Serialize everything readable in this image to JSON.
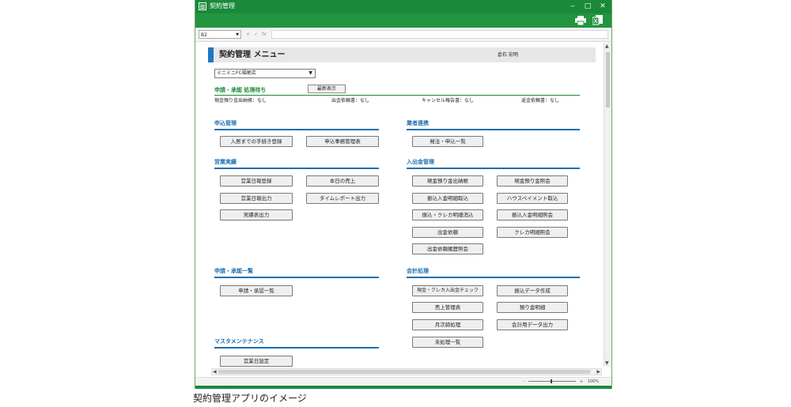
{
  "window": {
    "title": "契約管理",
    "controls": [
      "‒",
      "□",
      "✕"
    ]
  },
  "toolbar": {
    "icons": [
      "print-icon",
      "excel-export-icon"
    ]
  },
  "formula_bar": {
    "cell_ref": "B2",
    "cancel_symbol": "×",
    "enter_symbol": "✓",
    "fx_symbol": "fx",
    "formula": ""
  },
  "header": {
    "title": "契約管理 メニュー",
    "user": "倉石 宏明"
  },
  "shop_select": {
    "value": "ミニミニFC福尾店"
  },
  "pending": {
    "title": "申請・承認 処理待ち",
    "refresh_label": "最新表示",
    "items": [
      "現金預り金出納帳：なし",
      "出金依頼書：なし",
      "キャンセル報告書：なし",
      "返金依頼書：なし"
    ]
  },
  "sections": {
    "application": {
      "title": "申込管理",
      "buttons": [
        "入居までの手続き登録",
        "申込事務管理表"
      ]
    },
    "vendor": {
      "title": "業者連携",
      "buttons": [
        "発注・申込一覧"
      ]
    },
    "sales": {
      "title": "営業実績",
      "buttons": [
        "営業日報登録",
        "本日の売上",
        "営業日報出力",
        "タイムレポート出力",
        "実績表出力"
      ]
    },
    "cashflow": {
      "title": "入出金管理",
      "buttons": [
        "現金預り金出納帳",
        "現金預り金照会",
        "振込入金明細取込",
        "ハウスペイメント取込",
        "振込・クレカ明細消込",
        "振込入金明細照会",
        "出金依頼",
        "クレカ明細照会",
        "出金依頼履歴照会"
      ]
    },
    "approval": {
      "title": "申請・承認一覧",
      "buttons": [
        "申請・承認一覧"
      ]
    },
    "accounting": {
      "title": "会計処理",
      "buttons": [
        "現金・クレカ入出金チェック",
        "振込データ作成",
        "売上管理表",
        "預り金明細",
        "月次締処理",
        "会計用データ出力",
        "未処理一覧"
      ]
    },
    "master": {
      "title": "マスタメンテナンス",
      "buttons": [
        "営業日設定"
      ]
    }
  },
  "status_bar": {
    "zoom_minus": "-",
    "zoom_plus": "+",
    "zoom": "100%"
  },
  "caption": "契約管理アプリのイメージ",
  "colors": {
    "title_bar": "#1a8a3a",
    "section_heading": "#1f6fb0",
    "pending_heading": "#1a8a3a",
    "header_accent": "#1f78c0"
  }
}
